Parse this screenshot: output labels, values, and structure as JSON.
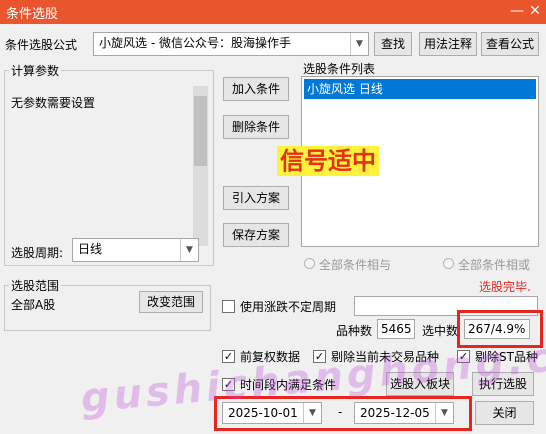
{
  "window": {
    "title": "条件选股",
    "minimize_glyph": "—",
    "close_glyph": "✕"
  },
  "formula": {
    "label": "条件选股公式",
    "value": "小旋风选  -  微信公众号：股海操作手",
    "find_button": "查找",
    "usage_button": "用法注释",
    "view_button": "查看公式"
  },
  "calc_params": {
    "group_label": "计算参数",
    "message": "无参数需要设置",
    "period_label": "选股周期:",
    "period_value": "日线"
  },
  "actions": {
    "add_condition": "加入条件",
    "delete_condition": "删除条件",
    "import_plan": "引入方案",
    "save_plan": "保存方案"
  },
  "condition_list": {
    "label": "选股条件列表",
    "items": [
      "小旋风选  日线"
    ]
  },
  "overlay": {
    "signal_text": "信号适中",
    "watermark": "gushichanghong.com"
  },
  "logic": {
    "all_and": "全部条件相与",
    "all_or": "全部条件相或"
  },
  "status": {
    "done_text": "选股完毕."
  },
  "range": {
    "group_label": "选股范围",
    "value": "全部A股",
    "change_button": "改变范围"
  },
  "options": {
    "use_volatile_period": "使用涨跌不定周期",
    "forward_adjust": "前复权数据",
    "exclude_untraded": "剔除当前未交易品种",
    "exclude_st": "剔除ST品种",
    "time_period_satisfy": "时间段内满足条件"
  },
  "stats": {
    "total_label": "品种数",
    "total_value": "5465",
    "selected_label": "选中数",
    "selected_value": "267/4.9%"
  },
  "bottom": {
    "add_to_block": "选股入板块",
    "execute": "执行选股",
    "start_date": "2025-10-01",
    "date_separator": "-",
    "end_date": "2025-12-05",
    "close": "关闭"
  },
  "colors": {
    "titlebar": "#e9552c",
    "selection": "#0078d7",
    "highlight_box": "#e8251e",
    "signal_bg": "#fff23a",
    "signal_text": "#e53018"
  }
}
